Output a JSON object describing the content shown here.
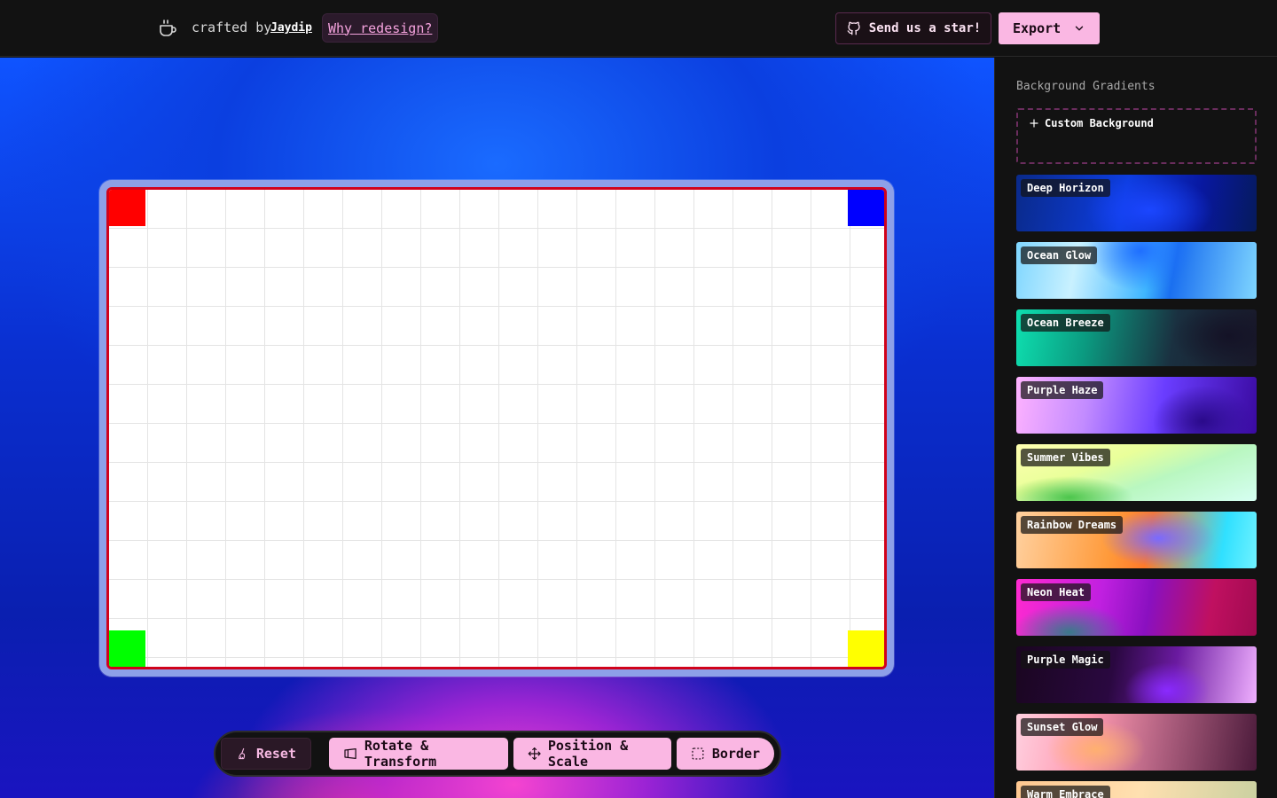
{
  "header": {
    "crafted_by": "crafted by",
    "author": "Jaydip",
    "why_redesign": "Why redesign?",
    "star_button": "Send us a star!",
    "export_button": "Export"
  },
  "canvas": {
    "corner_colors": {
      "top_left": "#ff0000",
      "top_right": "#0000ff",
      "bottom_left": "#00ff00",
      "bottom_right": "#ffff00"
    },
    "border_color": "#d0021b"
  },
  "toolbar": {
    "reset": "Reset",
    "rotate": "Rotate & Transform",
    "position": "Position & Scale",
    "border": "Border"
  },
  "sidebar": {
    "title": "Background Gradients",
    "custom_background": "Custom Background",
    "gradients": [
      {
        "name": "Deep Horizon"
      },
      {
        "name": "Ocean Glow"
      },
      {
        "name": "Ocean Breeze"
      },
      {
        "name": "Purple Haze"
      },
      {
        "name": "Summer Vibes"
      },
      {
        "name": "Rainbow Dreams"
      },
      {
        "name": "Neon Heat"
      },
      {
        "name": "Purple Magic"
      },
      {
        "name": "Sunset Glow"
      },
      {
        "name": "Warm Embrace"
      }
    ]
  },
  "colors": {
    "accent_pink": "#fab7e3",
    "header_bg": "#121212"
  }
}
